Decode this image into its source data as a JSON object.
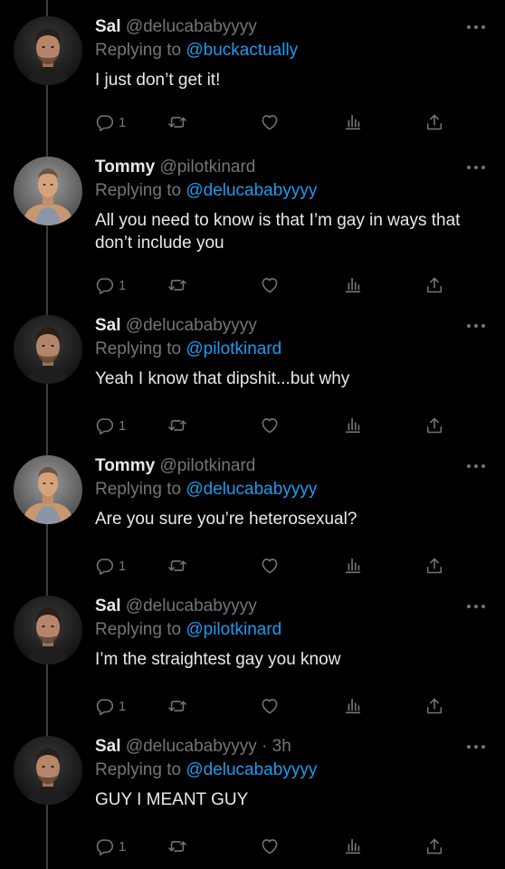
{
  "tweets": [
    {
      "name": "Sal",
      "handle": "@delucababyyyy",
      "time": "",
      "replying_prefix": "Replying to ",
      "replying_to": "@buckactually",
      "text": "I just don’t get it!",
      "reply_count": "1",
      "avatar": "sal"
    },
    {
      "name": "Tommy",
      "handle": "@pilotkinard",
      "time": "",
      "replying_prefix": "Replying to ",
      "replying_to": "@delucababyyyy",
      "text": "All you need to know is that I’m gay in ways that don’t include you",
      "reply_count": "1",
      "avatar": "tommy"
    },
    {
      "name": "Sal",
      "handle": "@delucababyyyy",
      "time": "",
      "replying_prefix": "Replying to ",
      "replying_to": "@pilotkinard",
      "text": "Yeah I know that dipshit...but why",
      "reply_count": "1",
      "avatar": "sal"
    },
    {
      "name": "Tommy",
      "handle": "@pilotkinard",
      "time": "",
      "replying_prefix": "Replying to ",
      "replying_to": "@delucababyyyy",
      "text": "Are you sure you’re heterosexual?",
      "reply_count": "1",
      "avatar": "tommy"
    },
    {
      "name": "Sal",
      "handle": "@delucababyyyy",
      "time": "",
      "replying_prefix": "Replying to ",
      "replying_to": "@pilotkinard",
      "text": "I’m the straightest gay you know",
      "reply_count": "1",
      "avatar": "sal"
    },
    {
      "name": "Sal",
      "handle": "@delucababyyyy",
      "time": " · 3h",
      "replying_prefix": "Replying to ",
      "replying_to": "@delucababyyyy",
      "text": "GUY I MEANT GUY",
      "reply_count": "1",
      "avatar": "sal"
    }
  ],
  "colors": {
    "background": "#000000",
    "text": "#e7e9ea",
    "secondary": "#71767b",
    "mention": "#1d9bf0",
    "thread_line": "#3a3d41"
  },
  "icons": [
    "reply-icon",
    "retweet-icon",
    "like-icon",
    "views-icon",
    "share-icon",
    "more-icon"
  ]
}
